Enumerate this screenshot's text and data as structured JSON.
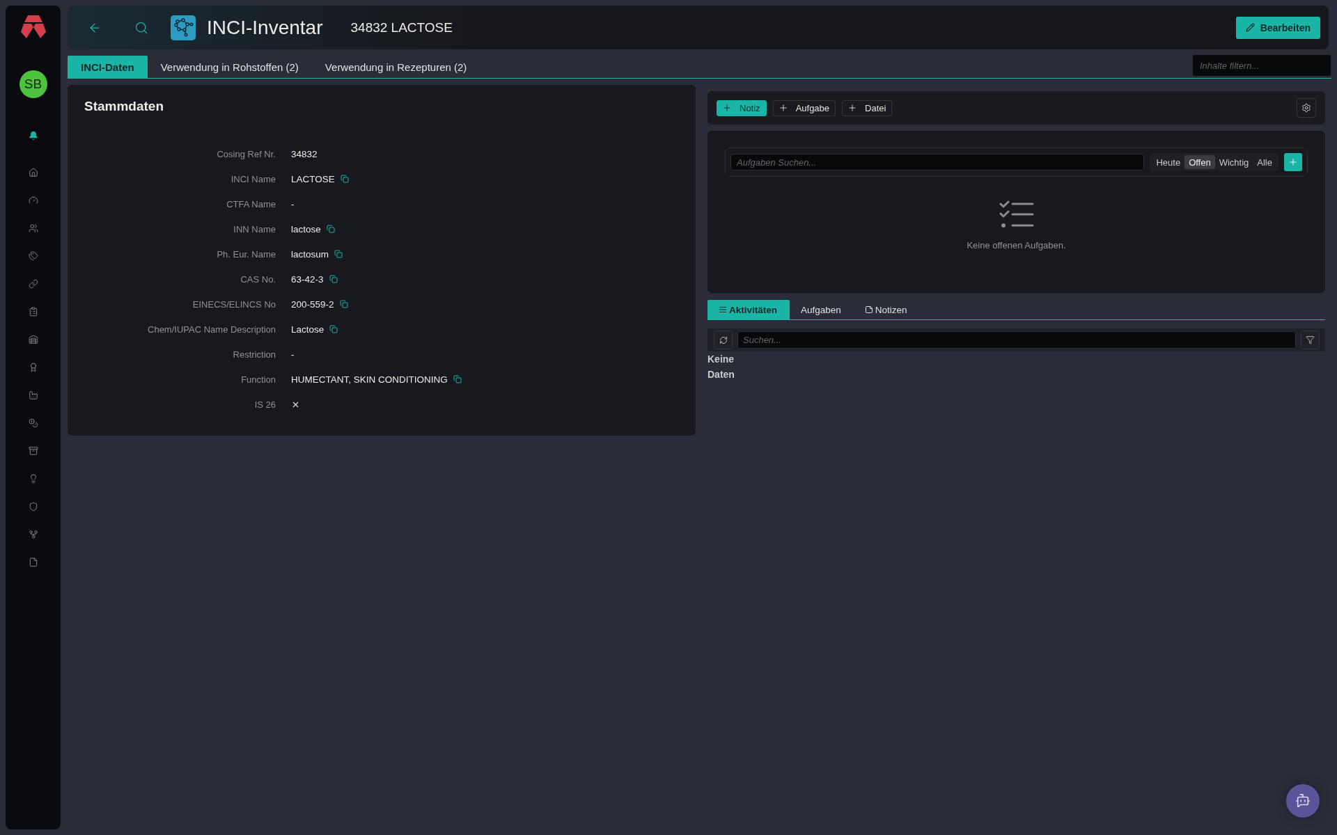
{
  "sidebar": {
    "avatar": "SB",
    "nav_items": [
      {
        "selected": true
      },
      {
        "selected": false
      },
      {
        "selected": false
      },
      {
        "selected": false
      },
      {
        "selected": false
      },
      {
        "selected": false
      },
      {
        "selected": false
      },
      {
        "selected": false
      },
      {
        "selected": false
      },
      {
        "selected": false
      },
      {
        "selected": false
      },
      {
        "selected": false
      },
      {
        "selected": false
      },
      {
        "selected": false
      },
      {
        "selected": false
      },
      {
        "selected": false
      }
    ]
  },
  "header": {
    "app_title": "INCI-Inventar",
    "record_title": "34832 LACTOSE",
    "edit_button": "Bearbeiten"
  },
  "tabs": [
    {
      "label": "INCI-Daten",
      "selected": true
    },
    {
      "label": "Verwendung in Rohstoffen (2)",
      "selected": false
    },
    {
      "label": "Verwendung in Rezepturen (2)",
      "selected": false
    }
  ],
  "filter": {
    "placeholder": "Inhalte filtern..."
  },
  "stammdaten": {
    "title": "Stammdaten",
    "fields": [
      {
        "label": "Cosing Ref Nr.",
        "kind": "text",
        "value": "34832",
        "copyable": false
      },
      {
        "label": "INCI Name",
        "kind": "text",
        "value": "LACTOSE",
        "copyable": true
      },
      {
        "label": "CTFA Name",
        "kind": "empty",
        "value": "-"
      },
      {
        "label": "INN Name",
        "kind": "text",
        "value": "lactose",
        "copyable": true
      },
      {
        "label": "Ph. Eur. Name",
        "kind": "text",
        "value": "lactosum",
        "copyable": true
      },
      {
        "label": "CAS No.",
        "kind": "text",
        "value": "63-42-3",
        "copyable": true
      },
      {
        "label": "EINECS/ELINCS No",
        "kind": "text",
        "value": "200-559-2",
        "copyable": true
      },
      {
        "label": "Chem/IUPAC Name Description",
        "kind": "text",
        "value": "Lactose",
        "copyable": true
      },
      {
        "label": "Restriction",
        "kind": "empty",
        "value": "-"
      },
      {
        "label": "Function",
        "kind": "text",
        "value": "HUMECTANT, SKIN CONDITIONING",
        "copyable": true
      },
      {
        "label": "IS 26",
        "kind": "flag",
        "checked": false
      }
    ]
  },
  "actions": [
    {
      "label": "Notiz",
      "primary": true
    },
    {
      "label": "Aufgabe",
      "primary": false
    },
    {
      "label": "Datei",
      "primary": false
    }
  ],
  "tasks": {
    "search": {
      "placeholder": "Aufgaben Suchen..."
    },
    "filters": [
      {
        "label": "Heute",
        "selected": false
      },
      {
        "label": "Offen",
        "selected": true
      },
      {
        "label": "Wichtig",
        "selected": false
      },
      {
        "label": "Alle",
        "selected": false
      }
    ],
    "empty_text": "Keine offenen Aufgaben."
  },
  "activity": {
    "tabs": [
      {
        "kind": "activities",
        "label": "Aktivitäten",
        "selected": true
      },
      {
        "kind": "tasks",
        "label": "Aufgaben",
        "selected": false
      },
      {
        "kind": "notes",
        "label": "Notizen",
        "selected": false
      }
    ],
    "search": {
      "placeholder": "Suchen..."
    },
    "empty_text": "Keine Daten"
  }
}
